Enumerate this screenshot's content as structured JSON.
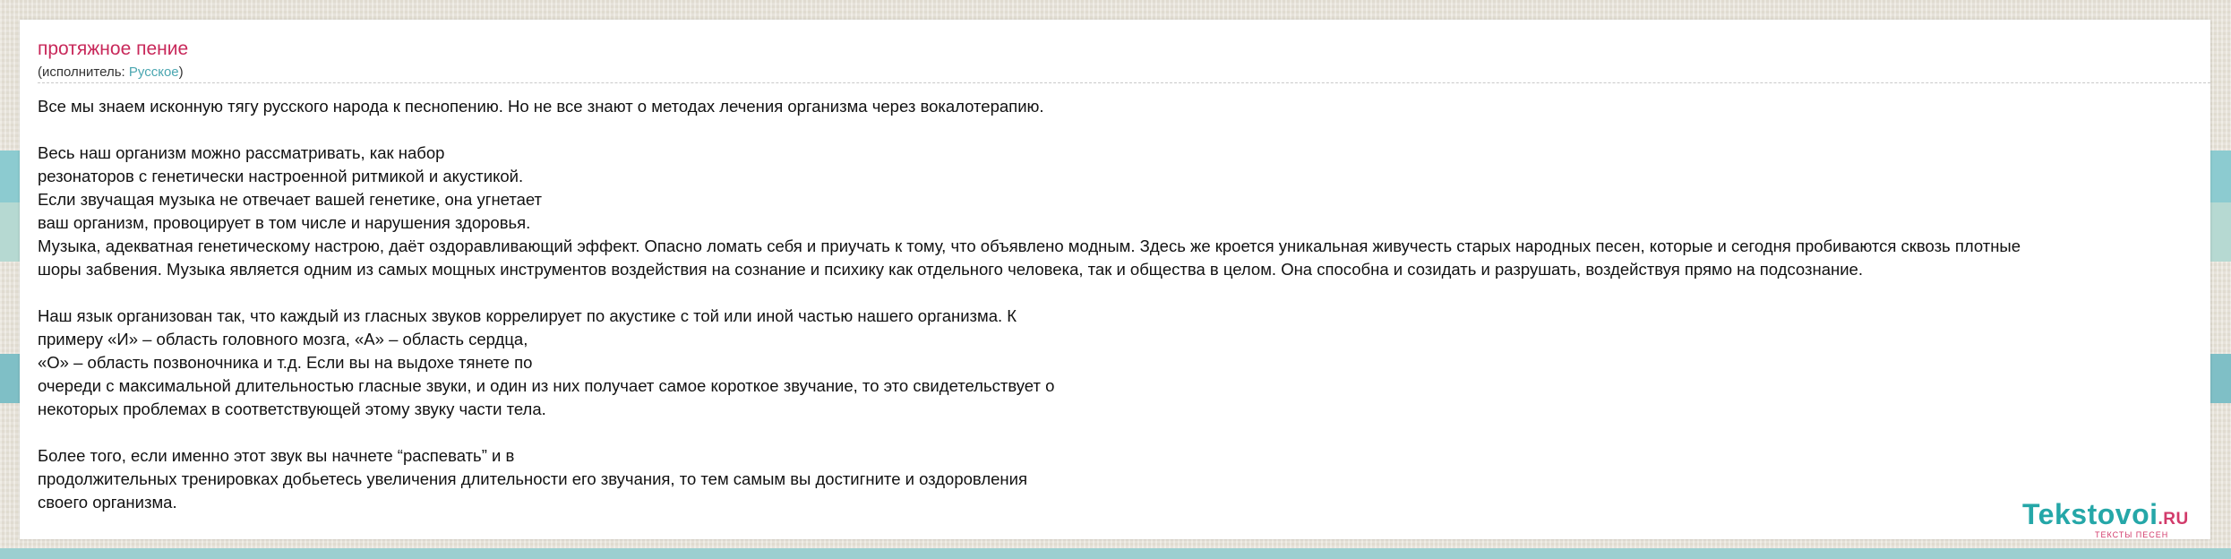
{
  "song": {
    "title": "протяжное пение",
    "artist_prefix": "(исполнитель: ",
    "artist": "Русское",
    "artist_suffix": ")"
  },
  "lyrics": [
    "Все мы знаем исконную тягу русского народа к песнопению. Но не все знают о методах лечения организма через вокалотерапию.",
    "",
    "Весь наш организм можно рассматривать, как набор",
    "резонаторов с генетически настроенной ритмикой и акустикой.",
    "Если звучащая музыка не отвечает вашей генетике, она угнетает",
    "ваш организм, провоцирует в том числе и нарушения здоровья.",
    "Музыка, адекватная генетическому настрою, даёт оздоравливающий эффект. Опасно ломать себя и приучать к тому, что объявлено модным. Здесь же кроется уникальная живучесть старых народных песен, которые и сегодня пробиваются сквозь плотные",
    "шоры забвения. Музыка является одним из самых мощных инструментов воздействия на сознание и психику как отдельного человека, так и общества в целом. Она способна и созидать и разрушать, воздействуя прямо на подсознание.",
    "",
    "Наш язык организован так, что каждый из гласных звуков коррелирует по акустике с той или иной частью нашего организма. К",
    "примеру «И» – область головного мозга, «А» – область сердца,",
    "«О» – область позвоночника и т.д. Если вы на выдохе тянете по",
    "очереди с максимальной длительностью гласные звуки, и один из них получает самое короткое звучание, то это свидетельствует о",
    "некоторых проблемах в соответствующей этому звуку части тела.",
    "",
    "Более того, если именно этот звук вы начнете “распевать” и в",
    "продолжительных тренировках добьетесь увеличения длительности его звучания, то тем самым вы достигните и оздоровления",
    "своего организма."
  ],
  "brand": {
    "name": "Tekstovoi",
    "tld": ".RU",
    "tagline": "ТЕКСТЫ ПЕСЕН"
  }
}
